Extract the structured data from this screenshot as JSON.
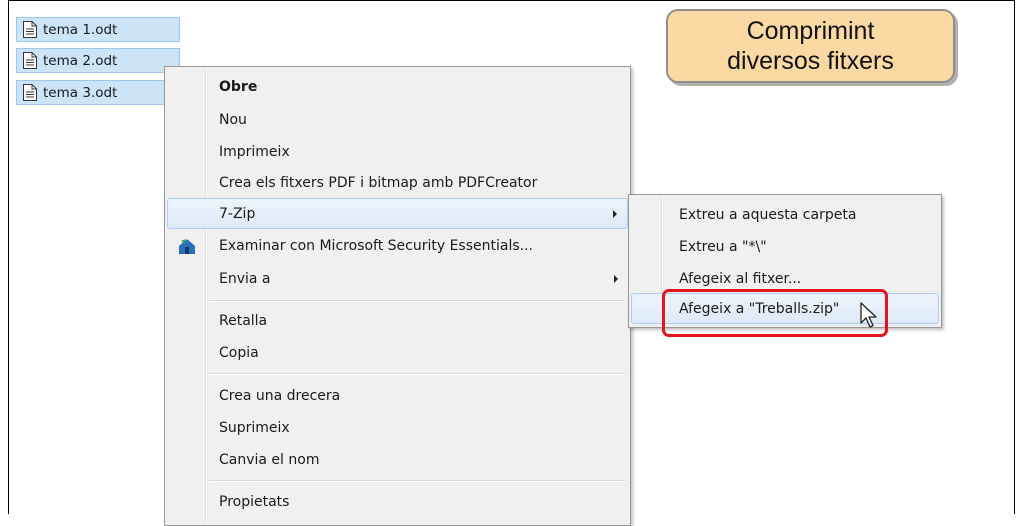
{
  "files": [
    {
      "name": "tema 1.odt",
      "icon": "document-icon"
    },
    {
      "name": "tema 2.odt",
      "icon": "document-icon"
    },
    {
      "name": "tema 3.odt",
      "icon": "document-icon"
    }
  ],
  "banner": {
    "line1": "Comprimint",
    "line2": "diversos fitxers"
  },
  "context_menu": {
    "items": [
      {
        "label": "Obre"
      },
      {
        "label": "Nou"
      },
      {
        "label": "Imprimeix"
      },
      {
        "label": "Crea els fitxers PDF i bitmap amb PDFCreator"
      },
      {
        "label": "7-Zip"
      },
      {
        "label": "Examinar con Microsoft Security Essentials..."
      },
      {
        "label": "Envia a"
      },
      {
        "label": "Retalla"
      },
      {
        "label": "Copia"
      },
      {
        "label": "Crea una drecera"
      },
      {
        "label": "Suprimeix"
      },
      {
        "label": "Canvia el nom"
      },
      {
        "label": "Propietats"
      }
    ]
  },
  "submenu_7zip": {
    "items": [
      {
        "label": "Extreu a aquesta carpeta"
      },
      {
        "label": "Extreu a \"*\\\""
      },
      {
        "label": "Afegeix al fitxer..."
      },
      {
        "label": "Afegeix a \"Treballs.zip\""
      }
    ]
  },
  "colors": {
    "banner_bg": "#fcd9a3",
    "selection_bg": "#cce4f7",
    "highlight_border": "#e3141b"
  }
}
